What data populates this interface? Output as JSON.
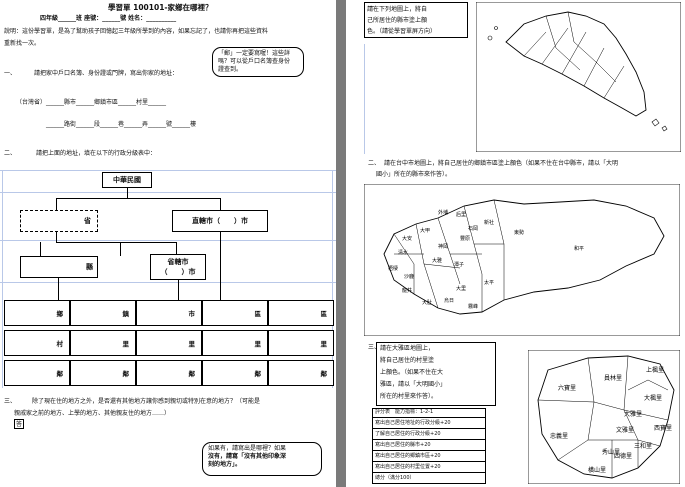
{
  "left": {
    "title": "學習單 100101-家鄉在哪裡？",
    "header_line": "四年級______班 座號：______號 姓名：__________",
    "intro": [
      "說明：這份學習單，是為了幫助孩子回憶起三年級所學到的內容，如果忘記了，也請你再把這些資料",
      "重新找一次。"
    ],
    "bubble_top": [
      "「郵」一定要寫喔！這些詳",
      "嗎？可以從戶口名簿查身份",
      "證查到。"
    ],
    "q1_label": "一、",
    "q1_text": "請把家中戶口名簿、身份證或門牌，寫出你家的地址：",
    "address_line1": "（台灣省）______縣市______鄉鎮市區______村里______",
    "address_line2": "______路街______段______巷______弄______號______樓",
    "q2_label": "二、",
    "q2_text": "請把上面的地址，填在以下的行政分級表中：",
    "tree": {
      "root": "中華民國",
      "province": "省",
      "municipality": "直轄市（　　）市",
      "county": "縣",
      "prov_city_top": "省轄市",
      "prov_city_bottom": "（　　）市",
      "row_town": [
        "鄉",
        "鎮",
        "市",
        "區",
        "區"
      ],
      "row_village": [
        "村",
        "里",
        "里",
        "里",
        "里"
      ],
      "row_neighborhood": [
        "鄰",
        "鄰",
        "鄰",
        "鄰",
        "鄰"
      ]
    },
    "q3_label": "三、",
    "q3_lines": [
      "除了現在住的地方之外，是否還有其他地方讓你感到親切或特別在意的地方？（可能是",
      "親戚家之前的地方、上學的地方、其他親友住的地方……）"
    ],
    "q3_box_char": "答",
    "bubble_bottom": [
      "如果有，請寫出是哪裡？如果",
      "沒有，請寫「沒有其他印象深",
      "刻的地方」。"
    ]
  },
  "right": {
    "q1_label": "一、",
    "q1_lines": [
      "請在下列地圖上，將自",
      "己所居住的縣市塗上顏",
      "色。（請從學習單屏方向）"
    ],
    "q2_label": "二、",
    "q2_line1": "請在台中市地圖上，將自己居住的鄉鎮市區塗上顏色（如果不住在台中縣市，請以「大明",
    "q2_line2": "國小」所在的縣市來作答）。",
    "taichung_labels": [
      "和平",
      "東勢",
      "新社",
      "石岡",
      "豐原",
      "后里",
      "外埔",
      "大甲",
      "大安",
      "清水",
      "梧棲",
      "沙鹿",
      "龍井",
      "大肚",
      "烏日",
      "霧峰",
      "大里",
      "太平",
      "潭子",
      "大雅",
      "神岡"
    ],
    "q3_label": "三、",
    "q3_lines": [
      "請在大雅區地圖上，",
      "將自己居住的村里塗",
      "上顏色。（如果不住在大",
      "雅區，請以「大明國小」",
      "所在的村里來作答）。"
    ],
    "score_header": "評分表　能力指標：1-2-1",
    "score_rows": [
      "寫出自己居住地址的行政分級+20",
      "了解自己居住的行政分級+20",
      "寫出自己居住的縣市+20",
      "寫出自己居住的鄉鎮市區+20",
      "寫出自己居住的村里位置+20",
      "總分（滿分100）"
    ],
    "daya_labels": [
      "六寶里",
      "員林里",
      "上楓里",
      "大楓里",
      "忠義里",
      "秀山里",
      "文雅里",
      "西寶里",
      "三和里",
      "橫山里",
      "四德里",
      "大雅里"
    ]
  }
}
